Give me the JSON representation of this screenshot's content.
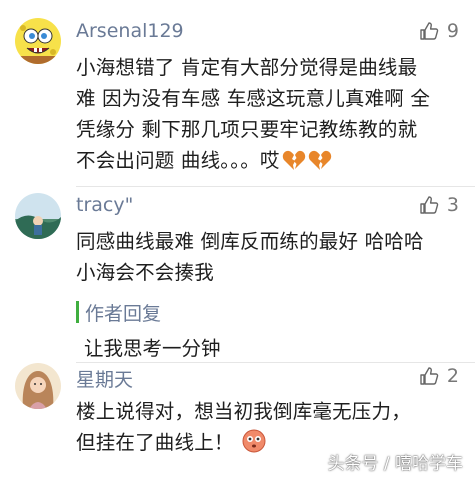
{
  "comments": [
    {
      "username": "Arsenal129",
      "likes": "9",
      "text_lines": [
        "小海想错了 肯定有大部分觉得是曲线最",
        "难 因为没有车感 车感这玩意儿真难啊 全",
        "凭缘分 剩下那几项只要牢记教练教的就",
        "不会出问题 曲线。。。哎"
      ],
      "avatar_icon": "spongebob-avatar",
      "trailing_emoji": "broken-heart-icon"
    },
    {
      "username": "tracy\"",
      "likes": "3",
      "text_lines": [
        "同感曲线最难 倒库反而练的最好 哈哈哈",
        "小海会不会揍我"
      ],
      "avatar_icon": "landscape-avatar"
    },
    {
      "author_label": "作者回复",
      "text": "让我思考一分钟",
      "author_bar_color": "#3fae3f"
    },
    {
      "username": "星期天",
      "likes": "2",
      "text_lines": [
        "楼上说得对，想当初我倒库毫无压力，",
        "但挂在了曲线上！"
      ],
      "avatar_icon": "girl-avatar",
      "trailing_emoji": "flushed-face-icon"
    }
  ],
  "watermark": "头条号 / 嘻哈学车",
  "colors": {
    "username": "#6a7a96",
    "text": "#1e1e1e",
    "like": "#777777"
  }
}
